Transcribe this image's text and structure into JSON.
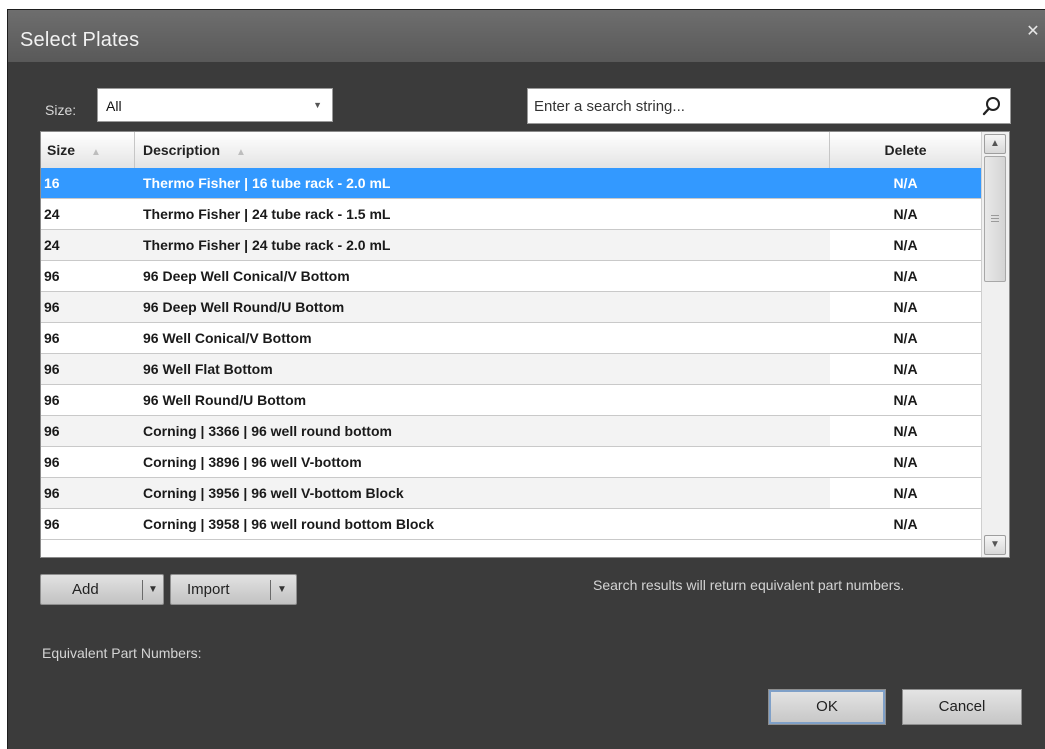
{
  "dialog": {
    "title": "Select Plates"
  },
  "filters": {
    "size_label": "Size:",
    "size_value": "All",
    "search_placeholder": "Enter a search string..."
  },
  "table": {
    "headers": {
      "size": "Size",
      "description": "Description",
      "delete": "Delete"
    },
    "rows": [
      {
        "size": "16",
        "description": "Thermo Fisher | 16 tube rack - 2.0 mL",
        "delete": "N/A",
        "selected": true
      },
      {
        "size": "24",
        "description": "Thermo Fisher | 24 tube rack - 1.5 mL",
        "delete": "N/A"
      },
      {
        "size": "24",
        "description": "Thermo Fisher | 24 tube rack - 2.0 mL",
        "delete": "N/A"
      },
      {
        "size": "96",
        "description": "96 Deep Well Conical/V Bottom",
        "delete": "N/A"
      },
      {
        "size": "96",
        "description": "96 Deep Well Round/U Bottom",
        "delete": "N/A"
      },
      {
        "size": "96",
        "description": "96 Well Conical/V Bottom",
        "delete": "N/A"
      },
      {
        "size": "96",
        "description": "96 Well Flat Bottom",
        "delete": "N/A"
      },
      {
        "size": "96",
        "description": "96 Well Round/U Bottom",
        "delete": "N/A"
      },
      {
        "size": "96",
        "description": "Corning | 3366 | 96 well round bottom",
        "delete": "N/A"
      },
      {
        "size": "96",
        "description": "Corning | 3896 | 96 well V-bottom",
        "delete": "N/A"
      },
      {
        "size": "96",
        "description": "Corning | 3956 | 96 well V-bottom Block",
        "delete": "N/A"
      },
      {
        "size": "96",
        "description": "Corning | 3958 | 96 well round bottom Block",
        "delete": "N/A"
      }
    ]
  },
  "actions": {
    "add_label": "Add",
    "import_label": "Import",
    "hint": "Search results will return equivalent part numbers.",
    "equivalent_label": "Equivalent Part Numbers:",
    "ok_label": "OK",
    "cancel_label": "Cancel"
  },
  "colors": {
    "selection": "#3399ff",
    "dialog_bg": "#3b3b3b"
  }
}
